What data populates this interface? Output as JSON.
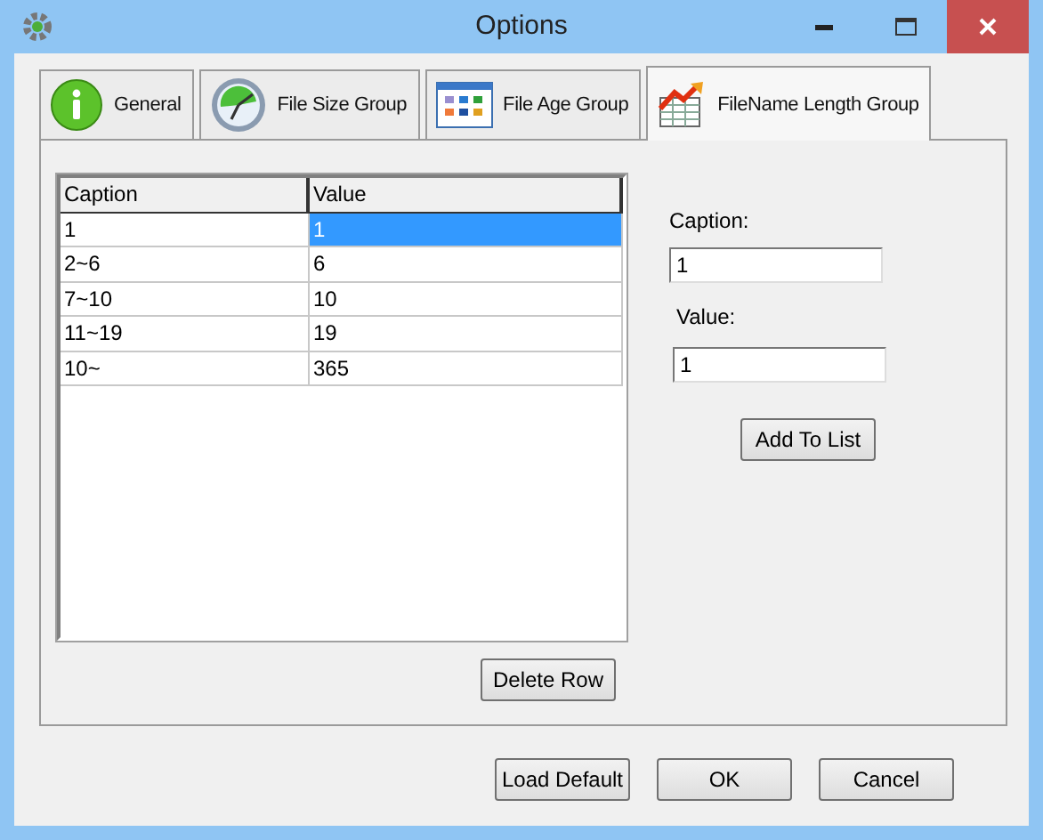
{
  "window": {
    "title": "Options"
  },
  "tabs": [
    {
      "label": "General",
      "kind": "info",
      "selected": false
    },
    {
      "label": "File Size Group",
      "kind": "clock",
      "selected": false
    },
    {
      "label": "File Age Group",
      "kind": "calendar",
      "selected": false
    },
    {
      "label": "FileName Length Group",
      "kind": "chart",
      "selected": true
    }
  ],
  "table": {
    "columns": [
      "Caption",
      "Value"
    ],
    "rows": [
      {
        "cells": [
          "1",
          "1"
        ],
        "selected": true
      },
      {
        "cells": [
          "2~6",
          "6"
        ],
        "selected": false
      },
      {
        "cells": [
          "7~10",
          "10"
        ],
        "selected": false
      },
      {
        "cells": [
          "11~19",
          "19"
        ],
        "selected": false
      },
      {
        "cells": [
          "10~",
          "365"
        ],
        "selected": false
      }
    ]
  },
  "form": {
    "caption_label": "Caption:",
    "caption_value": "1",
    "value_label": "Value:",
    "value_value": "1",
    "add_button": "Add To List"
  },
  "delete_button": "Delete Row",
  "buttons": [
    "Load Default",
    "OK",
    "Cancel"
  ]
}
